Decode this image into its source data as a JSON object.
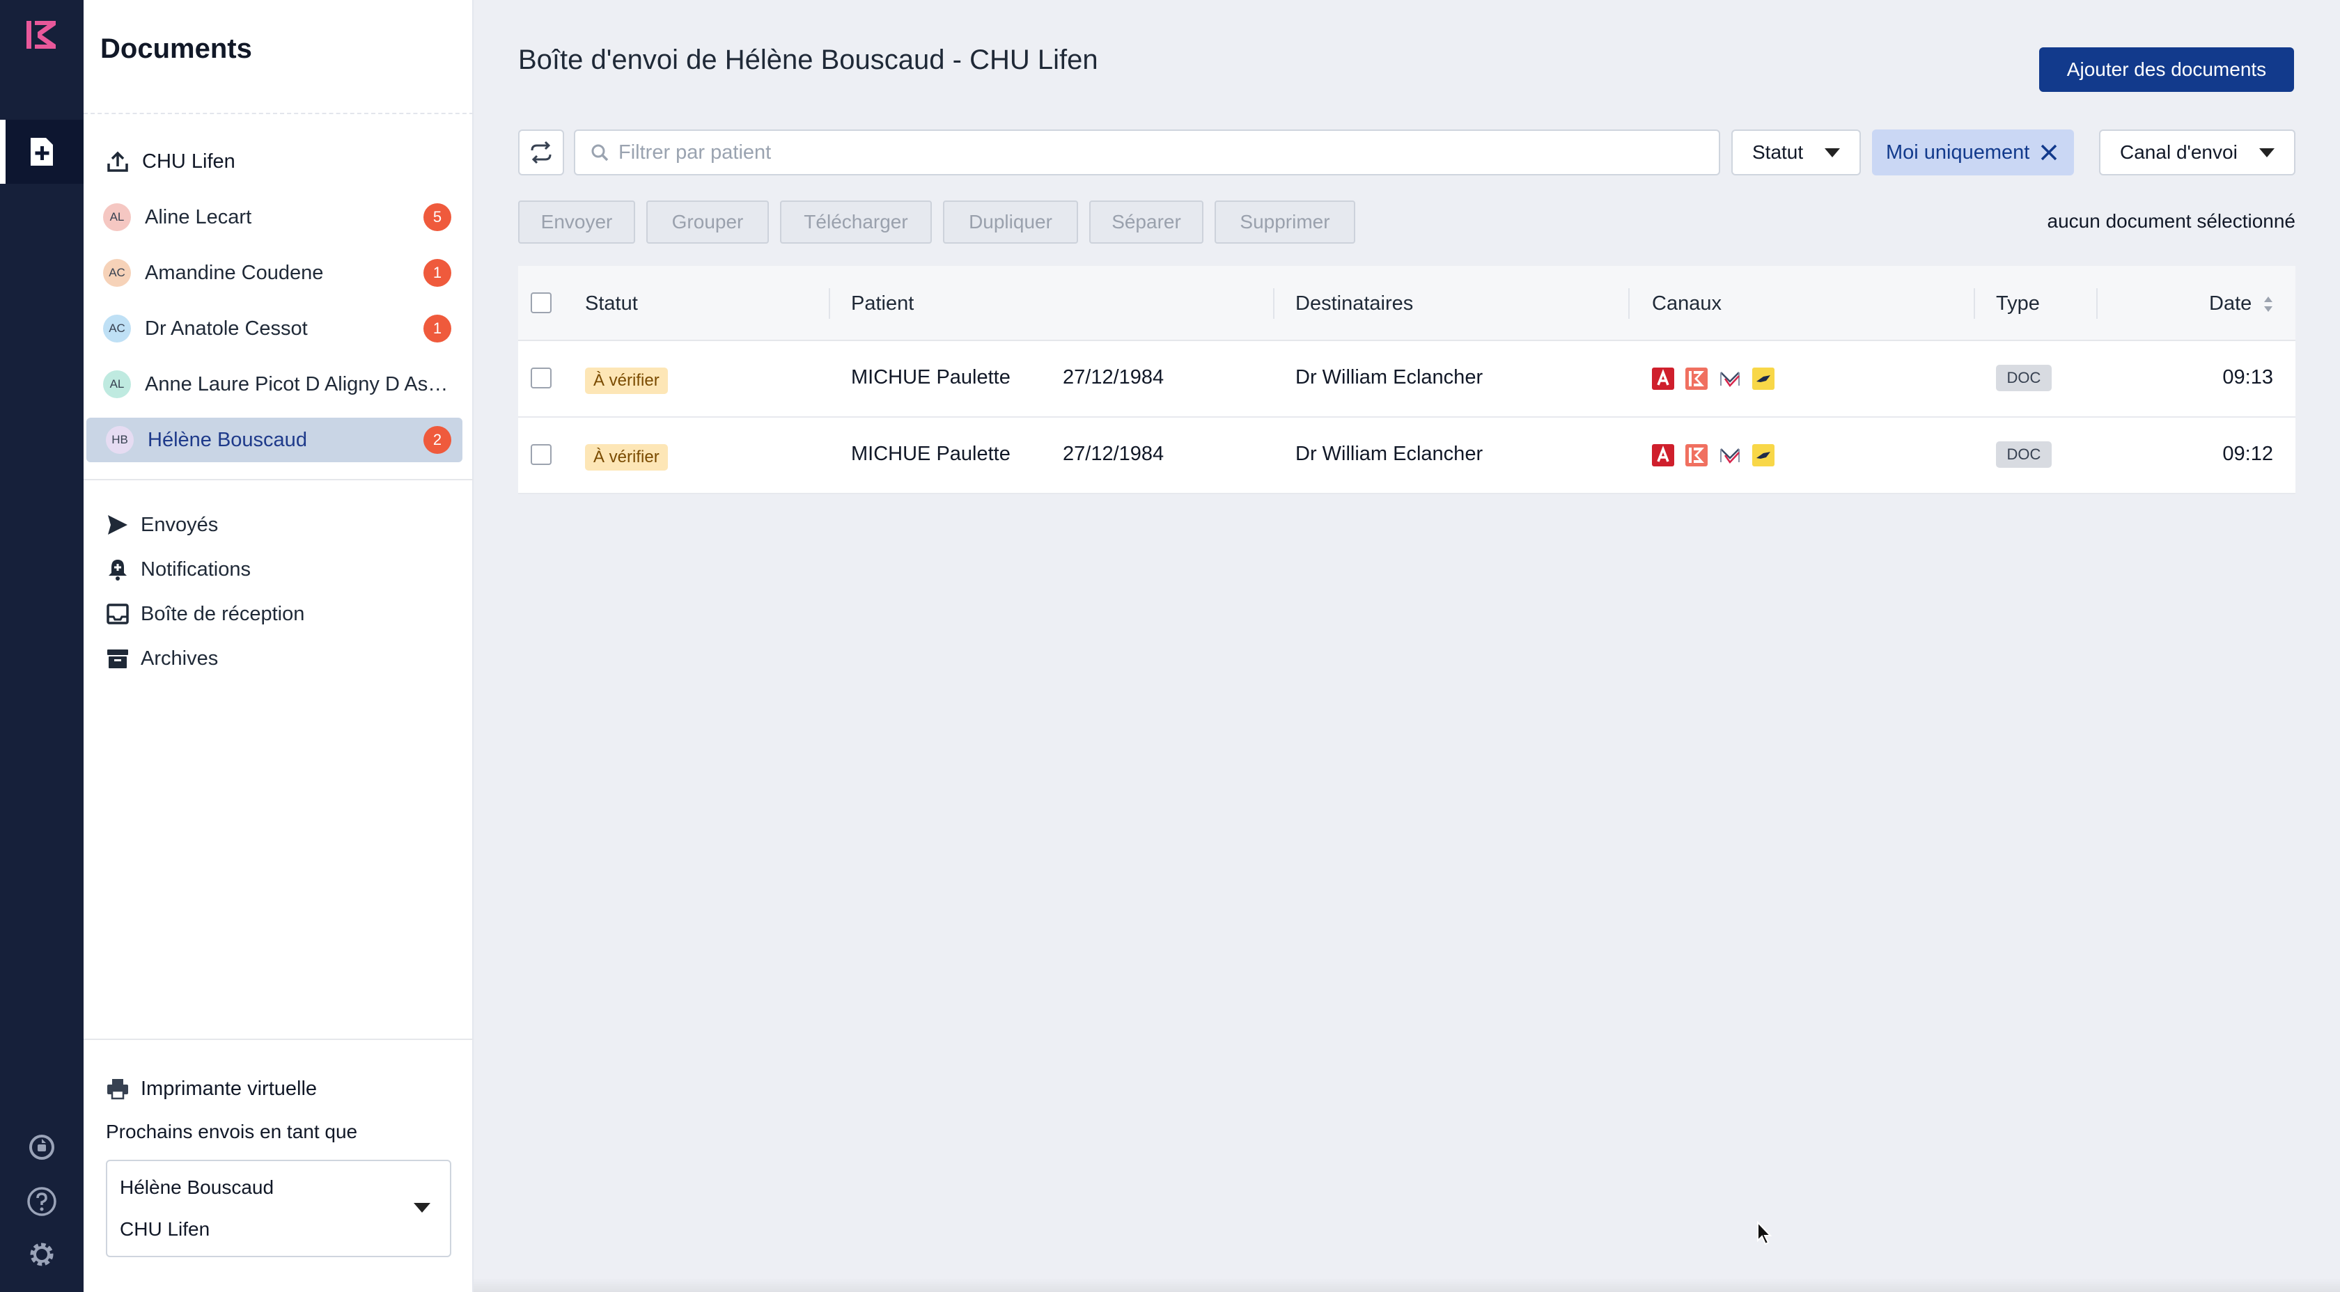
{
  "app": {
    "colors": {
      "rail": "#16203a",
      "accent": "#123a8c",
      "logo": "#e8589a",
      "badge": "#ef5a3c",
      "active_item": "#c9d5e5"
    }
  },
  "sidebar": {
    "title": "Documents",
    "organization": "CHU Lifen",
    "users": [
      {
        "initials": "AL",
        "name": "Aline Lecart",
        "count": "5",
        "avatar_color": "#f5c7c2"
      },
      {
        "initials": "AC",
        "name": "Amandine Coudene",
        "count": "1",
        "avatar_color": "#f6d2b8"
      },
      {
        "initials": "AC",
        "name": "Dr Anatole Cessot",
        "count": "1",
        "avatar_color": "#bfe0f5"
      },
      {
        "initials": "AL",
        "name": "Anne Laure Picot D Aligny D Ass...",
        "count": "",
        "avatar_color": "#bfeae0"
      },
      {
        "initials": "HB",
        "name": "Hélène Bouscaud",
        "count": "2",
        "avatar_color": "#e6dcf2",
        "active": true
      }
    ],
    "nav": [
      {
        "icon": "send-icon",
        "label": "Envoyés"
      },
      {
        "icon": "bell-icon",
        "label": "Notifications"
      },
      {
        "icon": "inbox-icon",
        "label": "Boîte de réception"
      },
      {
        "icon": "archive-icon",
        "label": "Archives"
      }
    ],
    "printer_label": "Imprimante virtuelle",
    "next_sends_label": "Prochains envois en tant que",
    "sender": {
      "name": "Hélène Bouscaud",
      "org": "CHU Lifen"
    }
  },
  "main": {
    "title": "Boîte d'envoi de Hélène Bouscaud - CHU Lifen",
    "add_button": "Ajouter des documents",
    "search_placeholder": "Filtrer par patient",
    "filters": {
      "status": "Statut",
      "chip": "Moi uniquement",
      "channel": "Canal d'envoi"
    },
    "actions": [
      "Envoyer",
      "Grouper",
      "Télécharger",
      "Dupliquer",
      "Séparer",
      "Supprimer"
    ],
    "selection_info": "aucun document sélectionné",
    "table": {
      "headers": {
        "status": "Statut",
        "patient": "Patient",
        "recipients": "Destinataires",
        "channels": "Canaux",
        "type": "Type",
        "date": "Date"
      },
      "rows": [
        {
          "status": "À vérifier",
          "patient": "MICHUE Paulette",
          "birthdate": "27/12/1984",
          "recipient": "Dr William Eclancher",
          "type": "DOC",
          "time": "09:13",
          "channels": [
            "apicrypt-icon",
            "lifen-icon",
            "mssante-icon",
            "post-icon"
          ]
        },
        {
          "status": "À vérifier",
          "patient": "MICHUE Paulette",
          "birthdate": "27/12/1984",
          "recipient": "Dr William Eclancher",
          "type": "DOC",
          "time": "09:12",
          "channels": [
            "apicrypt-icon",
            "lifen-icon",
            "mssante-icon",
            "post-icon"
          ]
        }
      ]
    }
  }
}
